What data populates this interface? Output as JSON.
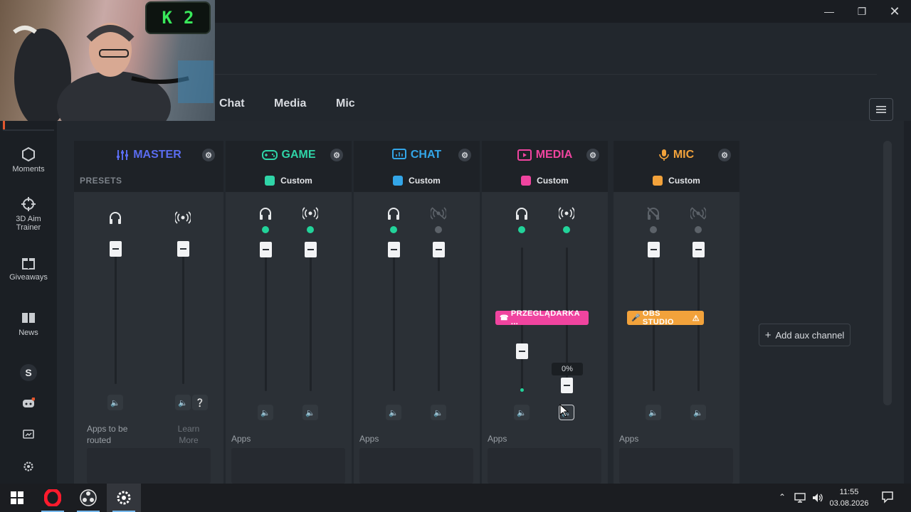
{
  "tabs": [
    {
      "label": "Chat"
    },
    {
      "label": "Media"
    },
    {
      "label": "Mic"
    }
  ],
  "sidebar": {
    "items": [
      {
        "label": "Moments",
        "icon": "hexagon-icon"
      },
      {
        "label": "3D Aim Trainer",
        "icon": "crosshair-icon"
      },
      {
        "label": "Giveaways",
        "icon": "gift-icon"
      },
      {
        "label": "News",
        "icon": "book-icon"
      }
    ],
    "badge": "S"
  },
  "webcam_overlay": {
    "letter": "K",
    "count": "2"
  },
  "channels": {
    "master": {
      "name": "MASTER",
      "color": "#5a6cf0",
      "presets_label": "PRESETS",
      "apps_label": "Apps to be routed",
      "learn_more": "Learn More"
    },
    "game": {
      "name": "GAME",
      "color": "#2fd4a7",
      "preset": "Custom",
      "apps_label": "Apps"
    },
    "chat": {
      "name": "CHAT",
      "color": "#33a6e8",
      "preset": "Custom",
      "apps_label": "Apps"
    },
    "media": {
      "name": "MEDIA",
      "color": "#f0449f",
      "preset": "Custom",
      "apps_label": "Apps",
      "app_chip": "PRZEGLĄDARKA ...",
      "monitor_level": 0.24,
      "stream_level": 0.0,
      "tooltip": "0%"
    },
    "mic": {
      "name": "MIC",
      "color": "#f2a23b",
      "preset": "Custom",
      "apps_label": "Apps",
      "app_chip": "OBS STUDIO"
    }
  },
  "aux": {
    "label": "Add aux channel"
  },
  "clock": {
    "time": "11:55",
    "date": "03.08.2026"
  },
  "colors": {
    "active_dot": "#22d39a",
    "inactive_dot": "#5c6269"
  }
}
